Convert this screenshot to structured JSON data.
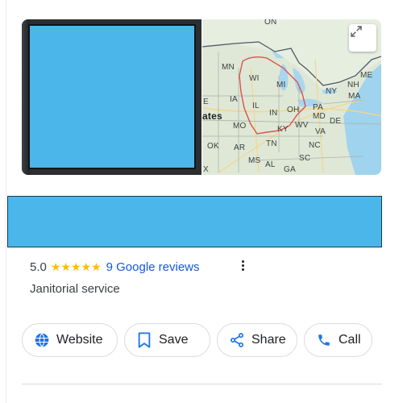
{
  "map": {
    "labels": [
      "ON",
      "MN",
      "WI",
      "MI",
      "IA",
      "IL",
      "IN",
      "OH",
      "NY",
      "NH",
      "ME",
      "MA",
      "PA",
      "MD",
      "DE",
      "MO",
      "KY",
      "WV",
      "VA",
      "OK",
      "AR",
      "TN",
      "NC",
      "MS",
      "AL",
      "GA",
      "SC",
      "ates",
      "E",
      "X"
    ],
    "expand_icon": "expand-icon"
  },
  "business": {
    "rating": "5.0",
    "stars": "★★★★★",
    "reviews_link": "9 Google reviews",
    "category": "Janitorial service"
  },
  "actions": [
    {
      "label": "Website",
      "icon": "globe-icon"
    },
    {
      "label": "Save",
      "icon": "bookmark-icon"
    },
    {
      "label": "Share",
      "icon": "share-icon"
    },
    {
      "label": "Call",
      "icon": "phone-icon"
    }
  ],
  "colors": {
    "redaction": "#4bb6ea",
    "link": "#1558d6",
    "star": "#fbbc04",
    "icon_blue": "#1a73e8",
    "outline": "#dadce0"
  }
}
